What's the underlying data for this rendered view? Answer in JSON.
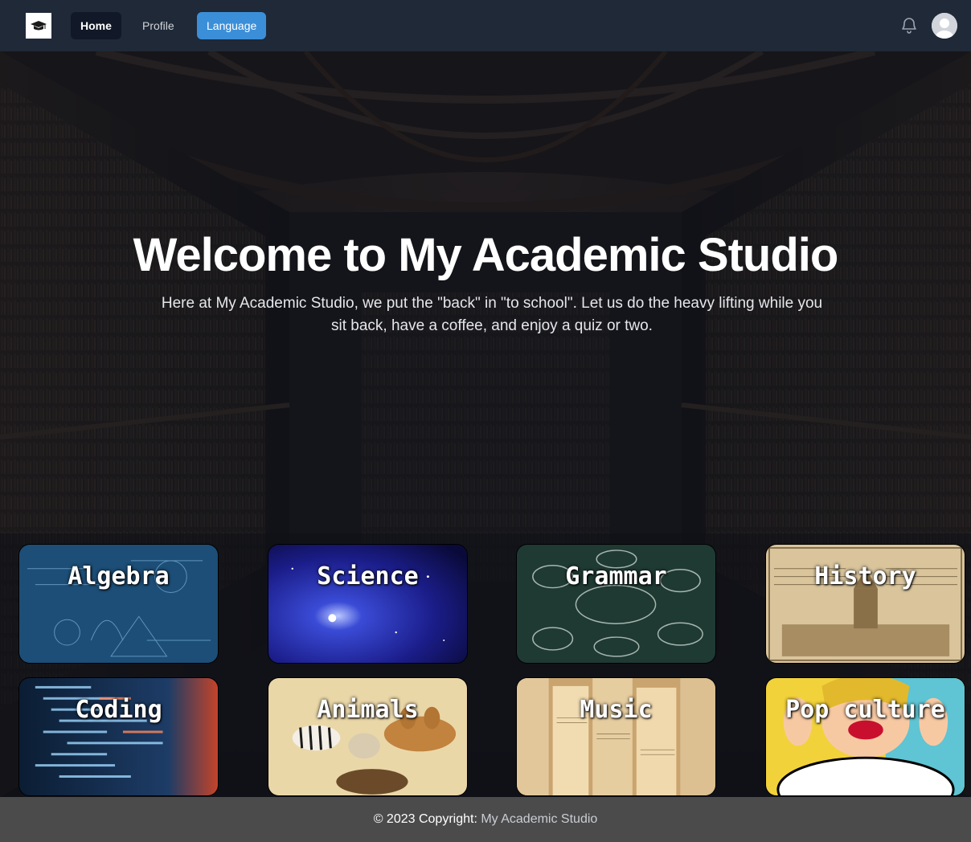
{
  "nav": {
    "logo_icon": "graduation-cap-icon",
    "links": [
      "Home",
      "Profile",
      "Language"
    ],
    "active": "Home",
    "bell_icon": "bell-icon",
    "avatar_icon": "user-avatar-icon",
    "colors": {
      "bar": "#1f2937",
      "active_bg": "#111827",
      "language_bg": "#3b8fd9"
    }
  },
  "hero": {
    "title": "Welcome to My Academic Studio",
    "subtitle": "Here at My Academic Studio, we put the \"back\" in \"to school\". Let us do the heavy lifting while you sit back, have a coffee, and enjoy a quiz or two."
  },
  "categories": [
    {
      "label": "Algebra"
    },
    {
      "label": "Science"
    },
    {
      "label": "Grammar"
    },
    {
      "label": "History"
    },
    {
      "label": "Coding"
    },
    {
      "label": "Animals"
    },
    {
      "label": "Music"
    },
    {
      "label": "Pop culture"
    }
  ],
  "footer": {
    "prefix": "© 2023 Copyright:",
    "link": "My Academic Studio"
  }
}
